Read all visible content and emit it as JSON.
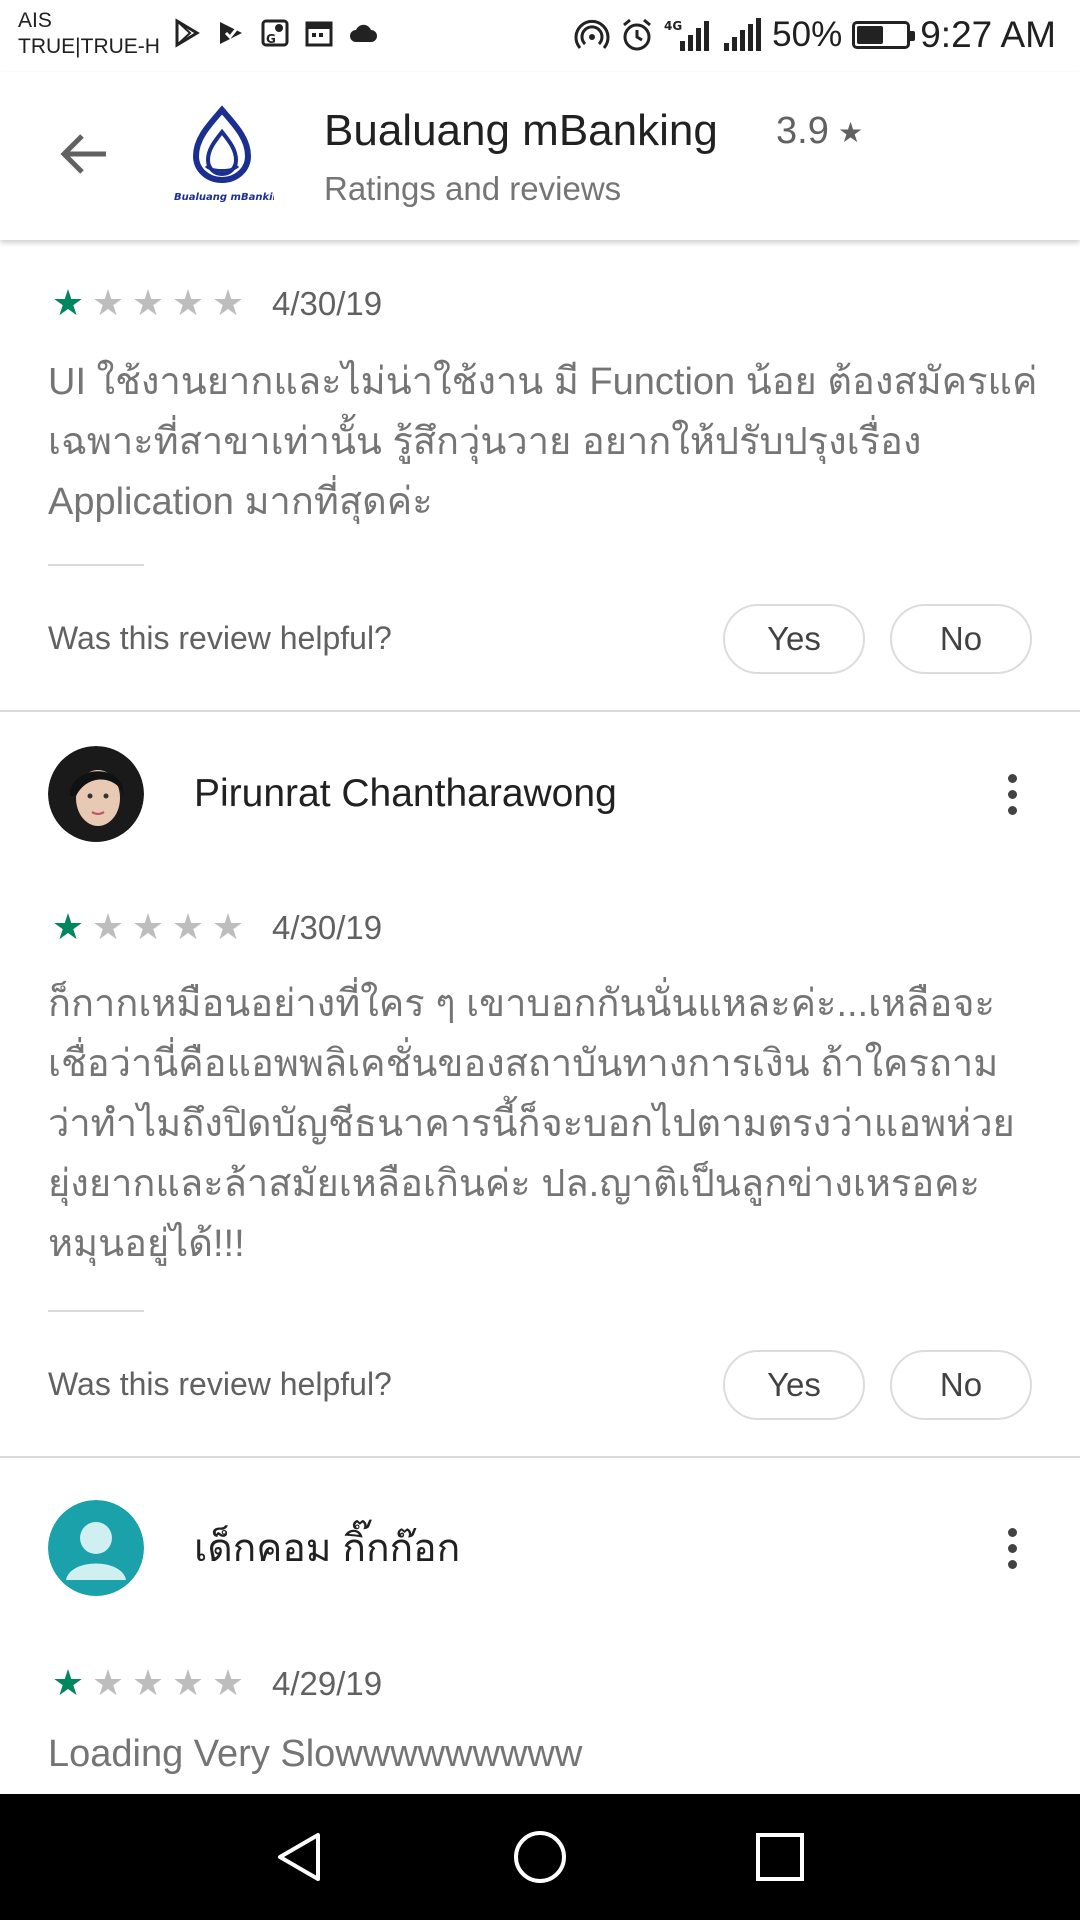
{
  "status_bar": {
    "carrier_line1": "AIS",
    "carrier_line2": "TRUE|TRUE-H",
    "network": "4G",
    "battery_percent": "50%",
    "battery_level": 0.5,
    "time": "9:27 AM"
  },
  "header": {
    "app_name": "Bualuang mBanking",
    "rating": "3.9",
    "rating_icon": "star",
    "subtitle": "Ratings and reviews",
    "logo_text": "Bualuang mBanking",
    "brand_colors": {
      "primary": "#1a2f8f",
      "accent": "#f26522"
    }
  },
  "helpful_prompt": "Was this review helpful?",
  "yes_label": "Yes",
  "no_label": "No",
  "star_color": "#01875f",
  "reviews": [
    {
      "rating": 1,
      "date": "4/30/19",
      "text": "UI ใช้งานยากและไม่น่าใช้งาน มี Function น้อย ต้องสมัครแค่เฉพาะที่สาขาเท่านั้น รู้สึกวุ่นวาย อยากให้ปรับปรุงเรื่อง Application มากที่สุดค่ะ"
    },
    {
      "reviewer": "Pirunrat Chantharawong",
      "rating": 1,
      "date": "4/30/19",
      "text": "ก็กากเหมือนอย่างที่ใคร ๆ เขาบอกกันนั่นแหละค่ะ...เหลือจะเชื่อว่านี่คือแอพพลิเคชั่นของสถาบันทางการเงิน ถ้าใครถามว่าทำไมถึงปิดบัญชีธนาคารนี้ก็จะบอกไปตามตรงว่าแอพห่วย ยุ่งยากและล้าสมัยเหลือเกินค่ะ ปล.ญาติเป็นลูกข่างเหรอคะ หมุนอยู่ได้!!!"
    },
    {
      "reviewer": "เด็กคอม กิ๊กก๊อก",
      "rating": 1,
      "date": "4/29/19",
      "text": "Loading Very Slowwwwwwwww"
    }
  ]
}
